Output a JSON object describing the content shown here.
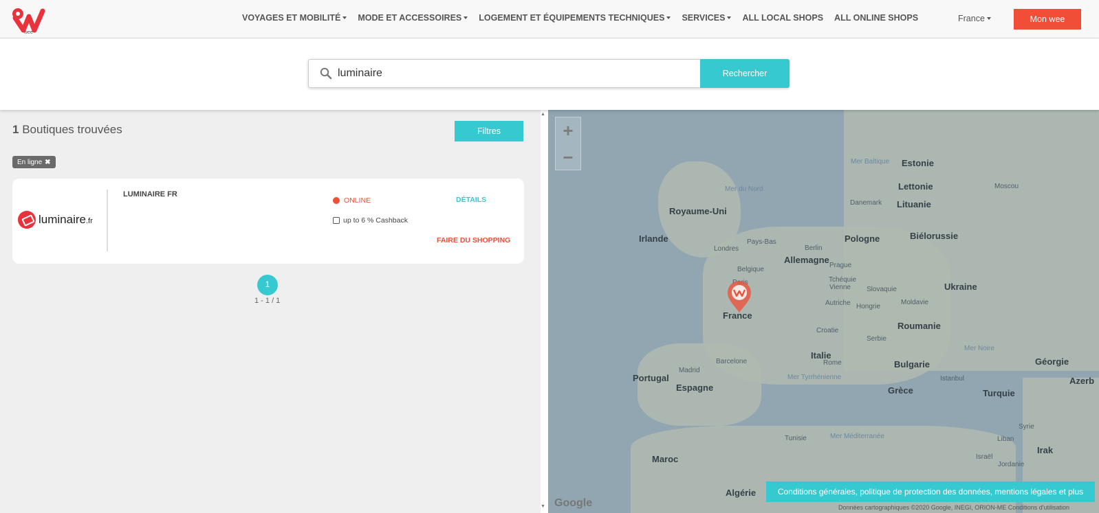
{
  "header": {
    "logo_text": "wee",
    "nav_items": [
      {
        "label": "VOYAGES ET MOBILITÉ",
        "has_caret": true
      },
      {
        "label": "MODE ET ACCESSOIRES",
        "has_caret": true
      },
      {
        "label": "LOGEMENT ET ÉQUIPEMENTS TECHNIQUES",
        "has_caret": true
      },
      {
        "label": "SERVICES",
        "has_caret": true
      },
      {
        "label": "ALL LOCAL SHOPS",
        "has_caret": false
      },
      {
        "label": "ALL ONLINE SHOPS",
        "has_caret": false
      }
    ],
    "country": "France",
    "account_button": "Mon wee",
    "accent": "#f04e37"
  },
  "search": {
    "value": "luminaire",
    "button": "Rechercher",
    "accent": "#36cad0"
  },
  "results": {
    "count": "1",
    "title_suffix": " Boutiques trouvées",
    "filter_button": "Filtres",
    "active_tag": "En ligne",
    "tag_close": "✖",
    "shops": [
      {
        "logo_text": "luminaire",
        "logo_suffix": ".fr",
        "name": "LUMINAIRE FR",
        "mode": "ONLINE",
        "cashback": "up to 6 % Cashback",
        "details": "DÉTAILS",
        "shop_link": "FAIRE DU SHOPPING"
      }
    ],
    "page": "1",
    "page_count": "1 - 1 / 1"
  },
  "map": {
    "zoom_in": "+",
    "zoom_out": "−",
    "labels": [
      {
        "text": "Estonie",
        "kind": "big"
      },
      {
        "text": "Mer Baltique",
        "kind": "water"
      },
      {
        "text": "Lettonie",
        "kind": "big"
      },
      {
        "text": "Moscou",
        "kind": "small"
      },
      {
        "text": "Mer du Nord",
        "kind": "water"
      },
      {
        "text": "Danemark",
        "kind": "small"
      },
      {
        "text": "Lituanie",
        "kind": "big"
      },
      {
        "text": "Royaume-Uni",
        "kind": "big"
      },
      {
        "text": "Biélorussie",
        "kind": "big"
      },
      {
        "text": "Irlande",
        "kind": "big"
      },
      {
        "text": "Pays-Bas",
        "kind": "small"
      },
      {
        "text": "Pologne",
        "kind": "big"
      },
      {
        "text": "Berlin",
        "kind": "small"
      },
      {
        "text": "Londres",
        "kind": "small"
      },
      {
        "text": "Allemagne",
        "kind": "big"
      },
      {
        "text": "Belgique",
        "kind": "small"
      },
      {
        "text": "Prague",
        "kind": "small"
      },
      {
        "text": "Paris",
        "kind": "small"
      },
      {
        "text": "Tchéquie",
        "kind": "small"
      },
      {
        "text": "Ukraine",
        "kind": "big"
      },
      {
        "text": "Vienne",
        "kind": "small"
      },
      {
        "text": "Slovaquie",
        "kind": "small"
      },
      {
        "text": "Moldavie",
        "kind": "small"
      },
      {
        "text": "Autriche",
        "kind": "small"
      },
      {
        "text": "Hongrie",
        "kind": "small"
      },
      {
        "text": "France",
        "kind": "big"
      },
      {
        "text": "Roumanie",
        "kind": "big"
      },
      {
        "text": "Croatie",
        "kind": "small"
      },
      {
        "text": "Serbie",
        "kind": "small"
      },
      {
        "text": "Mer Noire",
        "kind": "water"
      },
      {
        "text": "Italie",
        "kind": "big"
      },
      {
        "text": "Géorgie",
        "kind": "big"
      },
      {
        "text": "Barcelone",
        "kind": "small"
      },
      {
        "text": "Bulgarie",
        "kind": "big"
      },
      {
        "text": "Rome",
        "kind": "small"
      },
      {
        "text": "Madrid",
        "kind": "small"
      },
      {
        "text": "Portugal",
        "kind": "big"
      },
      {
        "text": "Mer Tyrrhénienne",
        "kind": "water"
      },
      {
        "text": "Istanbul",
        "kind": "small"
      },
      {
        "text": "Espagne",
        "kind": "big"
      },
      {
        "text": "Grèce",
        "kind": "big"
      },
      {
        "text": "Turquie",
        "kind": "big"
      },
      {
        "text": "Azerb",
        "kind": "big"
      },
      {
        "text": "Syrie",
        "kind": "small"
      },
      {
        "text": "Tunisie",
        "kind": "small"
      },
      {
        "text": "Mer Méditerranée",
        "kind": "water"
      },
      {
        "text": "Liban",
        "kind": "small"
      },
      {
        "text": "Maroc",
        "kind": "big"
      },
      {
        "text": "Irak",
        "kind": "big"
      },
      {
        "text": "Israël",
        "kind": "small"
      },
      {
        "text": "Jordanie",
        "kind": "small"
      },
      {
        "text": "Algérie",
        "kind": "big"
      }
    ],
    "attribution": "Données cartographiques ©2020 Google, INEGI, ORION-ME   Conditions d'utilisation",
    "google": "Google"
  },
  "footer": {
    "legal_link": "Conditions générales, politique de protection des données, mentions légales et plus"
  }
}
